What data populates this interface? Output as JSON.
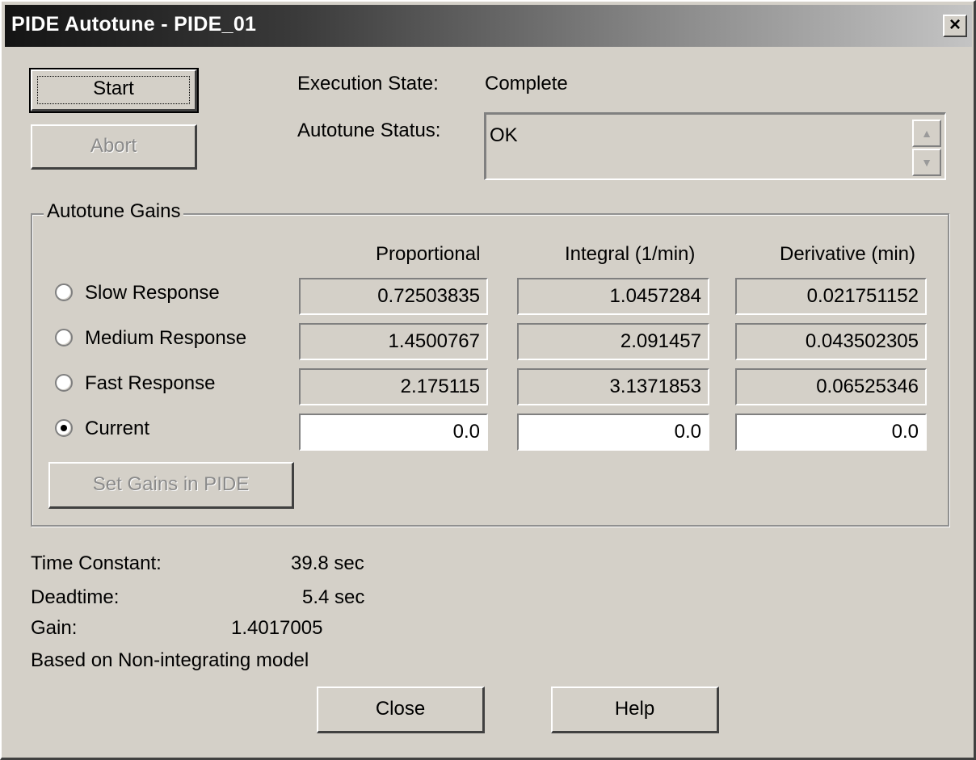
{
  "window": {
    "title": "PIDE Autotune - PIDE_01",
    "close_glyph": "×"
  },
  "buttons": {
    "start": "Start",
    "abort": "Abort",
    "set_gains": "Set Gains in PIDE",
    "close": "Close",
    "help": "Help"
  },
  "execution": {
    "label": "Execution State:",
    "value": "Complete"
  },
  "autotune_status": {
    "label": "Autotune Status:",
    "value": "OK",
    "scroll_up_glyph": "▲",
    "scroll_down_glyph": "▼"
  },
  "gains_group": {
    "title": "Autotune Gains",
    "columns": [
      "Proportional",
      "Integral (1/min)",
      "Derivative (min)"
    ],
    "rows": [
      {
        "label": "Slow Response",
        "selected": false,
        "values": [
          "0.72503835",
          "1.0457284",
          "0.021751152"
        ]
      },
      {
        "label": "Medium Response",
        "selected": false,
        "values": [
          "1.4500767",
          "2.091457",
          "0.043502305"
        ]
      },
      {
        "label": "Fast Response",
        "selected": false,
        "values": [
          "2.175115",
          "3.1371853",
          "0.06525346"
        ]
      },
      {
        "label": "Current",
        "selected": true,
        "values": [
          "0.0",
          "0.0",
          "0.0"
        ]
      }
    ]
  },
  "model": {
    "time_constant_label": "Time Constant:",
    "time_constant_value": "39.8 sec",
    "deadtime_label": "Deadtime:",
    "deadtime_value": "5.4 sec",
    "gain_label": "Gain:",
    "gain_value": "1.4017005",
    "model_note": "Based on Non-integrating model"
  },
  "colors": {
    "dialog_face": "#d4d0c8",
    "titlebar_dark": "#141414",
    "disabled_text": "#8a8a8a"
  }
}
